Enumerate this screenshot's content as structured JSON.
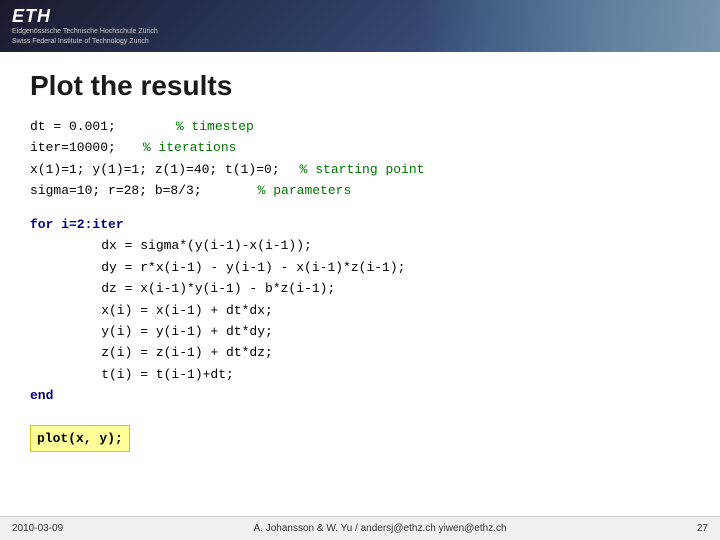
{
  "header": {
    "eth_logo": "ETH",
    "eth_subtitle_line1": "Eidgenössische Technische Hochschule Zürich",
    "eth_subtitle_line2": "Swiss Federal Institute of Technology Zurich"
  },
  "slide": {
    "title": "Plot the results"
  },
  "code": {
    "line1_code": "dt = 0.001;",
    "line1_comment": "% timestep",
    "line2_code": "iter=10000;",
    "line2_comment": "% iterations",
    "line3_code": "x(1)=1; y(1)=1; z(1)=40; t(1)=0;",
    "line3_comment": "% starting point",
    "line4_code": "sigma=10; r=28; b=8/3;",
    "line4_comment": "% parameters",
    "for_line": "for i=2:iter",
    "dx_line": "    dx = sigma*(y(i-1)-x(i-1));",
    "dy_line": "    dy = r*x(i-1) - y(i-1) - x(i-1)*z(i-1);",
    "dz_line": "    dz = x(i-1)*y(i-1) - b*z(i-1);",
    "xi_line": "    x(i) = x(i-1) + dt*dx;",
    "yi_line": "    y(i) = y(i-1) + dt*dy;",
    "zi_line": "    z(i) = z(i-1) + dt*dz;",
    "ti_line": "    t(i) = t(i-1)+dt;",
    "end_line": "end",
    "plot_line": "plot(x, y);"
  },
  "footer": {
    "date": "2010-03-09",
    "authors": "A. Johansson & W. Yu / andersj@ethz.ch yiwen@ethz.ch",
    "page": "27"
  }
}
